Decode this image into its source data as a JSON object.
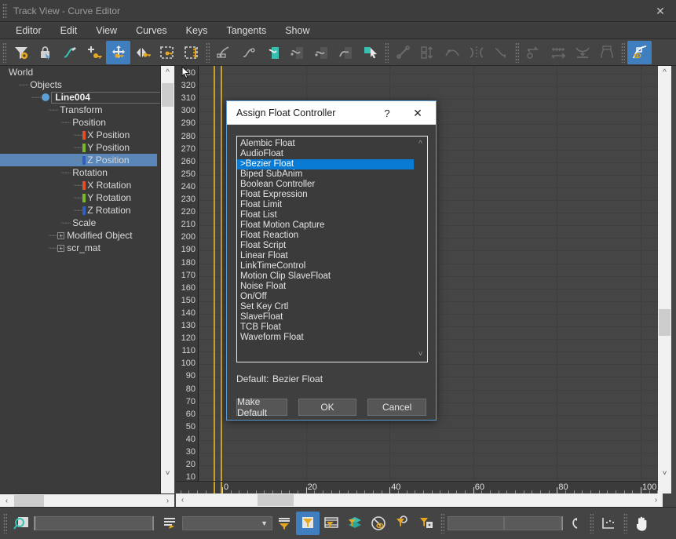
{
  "window": {
    "title": "Track View - Curve Editor",
    "close_icon": "close-icon"
  },
  "menubar": {
    "items": [
      "Editor",
      "Edit",
      "View",
      "Curves",
      "Keys",
      "Tangents",
      "Show"
    ]
  },
  "toolbar": {
    "groups": [
      {
        "icons": [
          {
            "name": "filter-settings-icon",
            "active": false,
            "dim": false
          },
          {
            "name": "lock-selection-icon",
            "active": false,
            "dim": false
          },
          {
            "name": "draw-curve-icon",
            "active": false,
            "dim": false
          },
          {
            "name": "add-key-icon",
            "active": false,
            "dim": false
          },
          {
            "name": "move-key-icon",
            "active": true,
            "dim": false
          },
          {
            "name": "slide-key-icon",
            "active": false,
            "dim": false
          },
          {
            "name": "scale-key-region-icon",
            "active": false,
            "dim": false
          },
          {
            "name": "scale-value-region-icon",
            "active": false,
            "dim": false
          }
        ]
      },
      {
        "icons": [
          {
            "name": "edit-key-tangent-icon",
            "active": false,
            "dim": false
          },
          {
            "name": "curve-tangent-icon",
            "active": false,
            "dim": false
          },
          {
            "name": "set-tangent-auto-icon",
            "active": false,
            "dim": false
          },
          {
            "name": "set-tangent-custom-icon",
            "active": false,
            "dim": false
          },
          {
            "name": "set-tangent-fast-icon",
            "active": false,
            "dim": false
          },
          {
            "name": "set-tangent-slow-icon",
            "active": false,
            "dim": false
          },
          {
            "name": "select-tool-icon",
            "active": false,
            "dim": false
          }
        ]
      },
      {
        "icons": [
          {
            "name": "lock-tangents-icon",
            "active": false,
            "dim": true
          },
          {
            "name": "align-keys-icon",
            "active": false,
            "dim": true
          },
          {
            "name": "ease-curve-icon",
            "active": false,
            "dim": true
          },
          {
            "name": "mirror-keys-icon",
            "active": false,
            "dim": true
          },
          {
            "name": "reduce-keys-icon",
            "active": false,
            "dim": true
          }
        ]
      },
      {
        "icons": [
          {
            "name": "loop-curve-icon",
            "active": false,
            "dim": true
          },
          {
            "name": "out-of-range-types-icon",
            "active": false,
            "dim": true
          },
          {
            "name": "snap-frames-icon",
            "active": false,
            "dim": true
          },
          {
            "name": "parameter-curve-icon",
            "active": false,
            "dim": true
          },
          {
            "name": "show-tangents-icon",
            "active": true,
            "dim": false
          }
        ]
      }
    ]
  },
  "tree": {
    "rows": [
      {
        "label": "World",
        "indent": 8,
        "type": "plain"
      },
      {
        "label": "Objects",
        "indent": 24,
        "type": "dash"
      },
      {
        "label": "Line004",
        "indent": 40,
        "type": "object",
        "bold": true
      },
      {
        "label": "Transform",
        "indent": 62,
        "type": "dash"
      },
      {
        "label": "Position",
        "indent": 78,
        "type": "dash"
      },
      {
        "label": "X Position",
        "indent": 94,
        "type": "track",
        "color": "#e0502a"
      },
      {
        "label": "Y Position",
        "indent": 94,
        "type": "track",
        "color": "#7ab827"
      },
      {
        "label": "Z Position",
        "indent": 94,
        "type": "track",
        "color": "#2f5fc0",
        "selected": true
      },
      {
        "label": "Rotation",
        "indent": 78,
        "type": "dash"
      },
      {
        "label": "X Rotation",
        "indent": 94,
        "type": "track",
        "color": "#e0502a"
      },
      {
        "label": "Y Rotation",
        "indent": 94,
        "type": "track",
        "color": "#7ab827"
      },
      {
        "label": "Z Rotation",
        "indent": 94,
        "type": "track",
        "color": "#2f5fc0"
      },
      {
        "label": "Scale",
        "indent": 78,
        "type": "dash"
      },
      {
        "label": "Modified Object",
        "indent": 62,
        "type": "plus"
      },
      {
        "label": "scr_mat",
        "indent": 62,
        "type": "plus"
      }
    ],
    "selection_color": "#5a86b8"
  },
  "chart_data": {
    "type": "line",
    "title": "",
    "xlabel": "",
    "ylabel": "",
    "grid": true,
    "legend": "none",
    "xlim": [
      -9,
      108
    ],
    "ylim": [
      5,
      335
    ],
    "x_ticks": [
      0,
      20,
      40,
      60,
      80,
      100
    ],
    "y_ticks": [
      330,
      320,
      310,
      300,
      290,
      280,
      270,
      260,
      250,
      240,
      230,
      220,
      210,
      200,
      190,
      180,
      170,
      160,
      150,
      140,
      130,
      120,
      110,
      100,
      90,
      80,
      70,
      60,
      50,
      40,
      30,
      20,
      10
    ],
    "series": [
      {
        "name": "Z Position",
        "color": "#2f5fc0",
        "values": []
      }
    ],
    "annotations": [
      {
        "name": "time-marker",
        "x": 0,
        "color": "#c9a227"
      },
      {
        "name": "time-marker",
        "x": 1.6,
        "color": "#c9a227"
      }
    ]
  },
  "dialog": {
    "title": "Assign Float Controller",
    "help_icon": "help-icon",
    "close_icon": "close-icon",
    "items": [
      "Alembic Float",
      "AudioFloat",
      ">Bezier Float",
      "Biped SubAnim",
      "Boolean Controller",
      "Float Expression",
      "Float Limit",
      "Float List",
      "Float Motion Capture",
      "Float Reaction",
      "Float Script",
      "Linear Float",
      "LinkTimeControl",
      "Motion Clip SlaveFloat",
      "Noise Float",
      "On/Off",
      "Set Key Crtl",
      "SlaveFloat",
      "TCB Float",
      "Waveform Float"
    ],
    "selected_index": 2,
    "selection_color": "#0a7bd4",
    "default_label": "Default:",
    "default_value": "Bezier Float",
    "buttons": {
      "make_default": "Make Default",
      "ok": "OK",
      "cancel": "Cancel"
    },
    "scroll_up_icon": "chevron-up-icon",
    "scroll_down_icon": "chevron-down-icon"
  },
  "scrollbars": {
    "left_arrow_icon": "chevron-left-icon",
    "right_arrow_icon": "chevron-right-icon",
    "up_arrow_icon": "chevron-up-icon",
    "down_arrow_icon": "chevron-down-icon"
  },
  "statusbar": {
    "search_icon": "search-filter-icon",
    "search_value": "",
    "list_edit_icon": "edit-list-icon",
    "combo_value": "",
    "combo_arrow_icon": "chevron-down-icon",
    "icons": [
      {
        "name": "filter-lines-icon",
        "active": false
      },
      {
        "name": "filter-selected-objects-icon",
        "active": true
      },
      {
        "name": "filter-animated-tracks-icon",
        "active": false
      },
      {
        "name": "filter-layers-icon",
        "active": false
      },
      {
        "name": "filter-visible-icon",
        "active": false
      },
      {
        "name": "filter-keyable-icon",
        "active": false
      },
      {
        "name": "filter-unlocked-icon",
        "active": false
      }
    ],
    "field_left_value": "",
    "field_right_value": "",
    "undo_curve_icon": "curve-reset-icon",
    "axis-keys_icon": "key-stats-icon",
    "pan_icon": "pan-hand-icon"
  }
}
